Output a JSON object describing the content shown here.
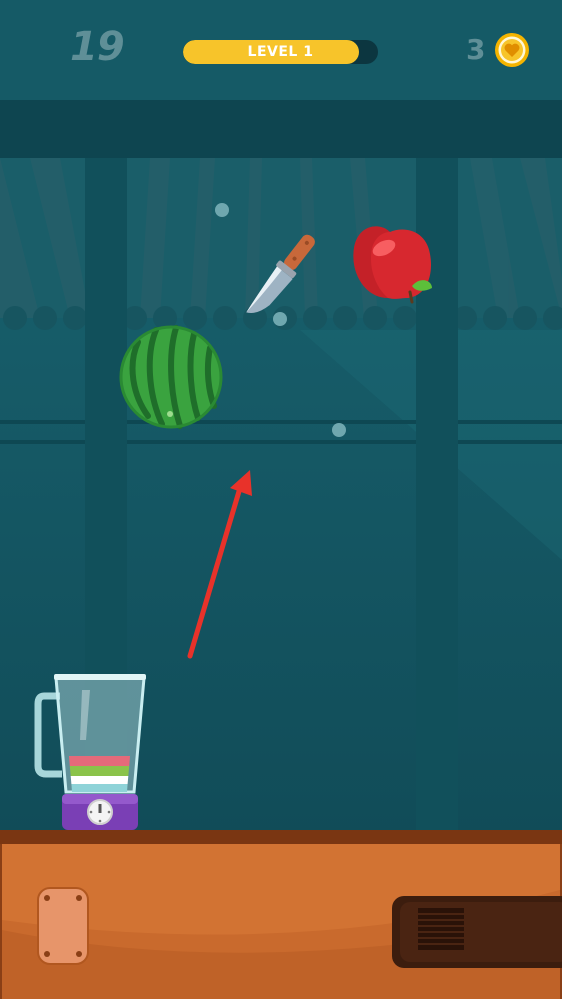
{
  "hud": {
    "score": "19",
    "level_label": "LEVEL 1",
    "level_progress": 0.9,
    "coins": "3"
  },
  "colors": {
    "background": "#14535f",
    "level_fill": "#f7c42a",
    "table": "#c96a2d",
    "aim_arrow": "#e8322a"
  },
  "icons": {
    "coin": "coin-heart-icon",
    "knife": "knife-icon",
    "apple": "apple-icon",
    "watermelon": "watermelon-icon",
    "blender": "blender-icon"
  },
  "blender": {
    "juice_layers": [
      "#e56a7a",
      "#8bc34a",
      "#ffffff",
      "#8fd3d8"
    ]
  }
}
